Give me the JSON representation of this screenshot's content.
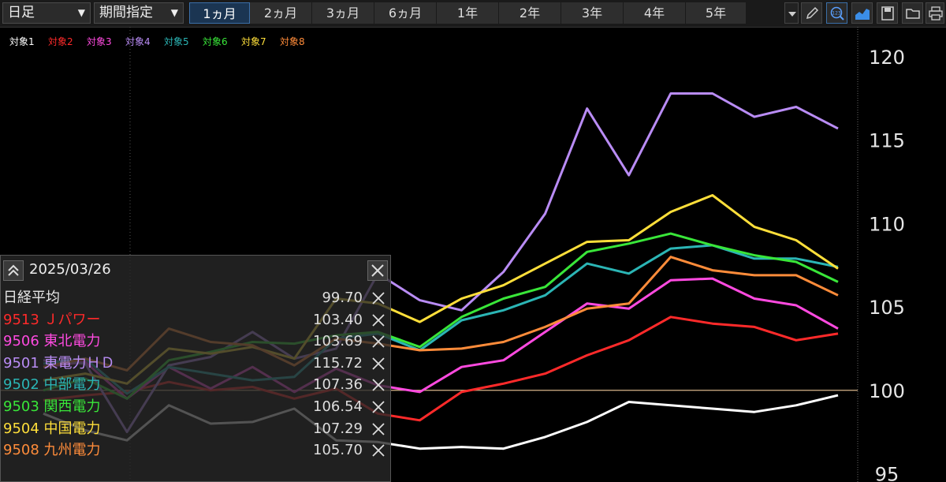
{
  "toolbar": {
    "interval_label": "日足",
    "range_mode_label": "期間指定",
    "periods": [
      "1ヵ月",
      "2ヵ月",
      "3ヵ月",
      "6ヵ月",
      "1年",
      "2年",
      "3年",
      "4年",
      "5年"
    ],
    "active_period": "1ヵ月",
    "icons": [
      "dropdown-icon",
      "pencil-icon",
      "indicator-icon",
      "area-chart-icon",
      "save-icon",
      "folder-icon",
      "print-icon"
    ]
  },
  "legend": [
    {
      "label": "対象1",
      "color": "#ffffff"
    },
    {
      "label": "対象2",
      "color": "#ff2a2a"
    },
    {
      "label": "対象3",
      "color": "#ff4ae0"
    },
    {
      "label": "対象4",
      "color": "#b98cf5"
    },
    {
      "label": "対象5",
      "color": "#2bb5b5"
    },
    {
      "label": "対象6",
      "color": "#39e639"
    },
    {
      "label": "対象7",
      "color": "#ffdf3a"
    },
    {
      "label": "対象8",
      "color": "#ff8c3a"
    }
  ],
  "panel": {
    "date": "2025/03/26",
    "rows": [
      {
        "name": "日経平均",
        "value": "99.70",
        "color": "#ffffff"
      },
      {
        "name": "9513 Ｊパワー",
        "value": "103.40",
        "color": "#ff2a2a"
      },
      {
        "name": "9506 東北電力",
        "value": "103.69",
        "color": "#ff4ae0"
      },
      {
        "name": "9501 東電力ＨＤ",
        "value": "115.72",
        "color": "#b98cf5"
      },
      {
        "name": "9502 中部電力",
        "value": "107.36",
        "color": "#2bb5b5"
      },
      {
        "name": "9503 関西電力",
        "value": "106.54",
        "color": "#39e639"
      },
      {
        "name": "9504 中国電力",
        "value": "107.29",
        "color": "#ffdf3a"
      },
      {
        "name": "9508 九州電力",
        "value": "105.70",
        "color": "#ff8c3a"
      }
    ]
  },
  "chart_data": {
    "type": "line",
    "y_ticks": [
      95,
      100,
      105,
      110,
      115,
      120
    ],
    "ylim": [
      94.5,
      121.8
    ],
    "baseline": 100,
    "baseline_color": "#d8b48a",
    "grid": "vertical dotted",
    "x_points": 22,
    "series": [
      {
        "name": "日経平均",
        "color": "#ffffff",
        "values": [
          98.6,
          97.6,
          97.0,
          99.1,
          98.0,
          98.1,
          98.9,
          97.0,
          96.9,
          96.5,
          96.6,
          96.5,
          97.2,
          98.1,
          99.3,
          99.1,
          98.9,
          98.7,
          99.1,
          99.7,
          null,
          null
        ]
      },
      {
        "name": "9513 Ｊパワー",
        "color": "#ff2a2a",
        "values": [
          99.4,
          99.7,
          99.9,
          100.5,
          100.0,
          100.2,
          99.5,
          100.1,
          98.6,
          98.2,
          99.9,
          100.4,
          101.0,
          102.1,
          103.0,
          104.4,
          104.0,
          103.8,
          103.0,
          103.4,
          null,
          null
        ]
      },
      {
        "name": "9506 東北電力",
        "color": "#ff4ae0",
        "values": [
          101.4,
          101.7,
          99.5,
          101.4,
          100.1,
          101.4,
          99.9,
          101.3,
          100.3,
          99.9,
          101.4,
          101.8,
          103.5,
          105.2,
          104.9,
          106.6,
          106.7,
          105.5,
          105.1,
          103.7,
          null,
          null
        ]
      },
      {
        "name": "9501 東電力ＨＤ",
        "color": "#b98cf5",
        "values": [
          101.8,
          101.6,
          97.5,
          101.5,
          102.0,
          103.5,
          101.9,
          102.5,
          107.0,
          105.4,
          104.8,
          107.1,
          110.6,
          116.9,
          112.9,
          117.8,
          117.8,
          116.4,
          117.0,
          115.7,
          null,
          null
        ]
      },
      {
        "name": "9502 中部電力",
        "color": "#2bb5b5",
        "values": [
          101.6,
          101.9,
          99.8,
          101.4,
          101.0,
          100.6,
          100.8,
          103.1,
          103.4,
          102.4,
          104.2,
          104.8,
          105.7,
          107.6,
          107.0,
          108.5,
          108.7,
          107.9,
          107.9,
          107.4,
          null,
          null
        ]
      },
      {
        "name": "9503 関西電力",
        "color": "#39e639",
        "values": [
          100.0,
          100.7,
          99.5,
          101.8,
          102.3,
          102.9,
          102.8,
          103.3,
          103.5,
          102.6,
          104.4,
          105.5,
          106.2,
          108.3,
          108.8,
          109.4,
          108.7,
          108.1,
          107.7,
          106.5,
          null,
          null
        ]
      },
      {
        "name": "9504 中国電力",
        "color": "#ffdf3a",
        "values": [
          100.6,
          101.0,
          100.4,
          102.5,
          102.2,
          102.6,
          101.9,
          105.5,
          105.2,
          104.1,
          105.5,
          106.3,
          107.6,
          108.9,
          109.0,
          110.7,
          111.7,
          109.8,
          109.0,
          107.3,
          null,
          null
        ]
      },
      {
        "name": "9508 九州電力",
        "color": "#ff8c3a",
        "values": [
          101.4,
          101.9,
          101.2,
          103.7,
          102.9,
          102.7,
          101.5,
          103.1,
          102.8,
          102.4,
          102.5,
          102.9,
          103.8,
          104.9,
          105.2,
          108.0,
          107.2,
          106.9,
          106.9,
          105.7,
          null,
          null
        ]
      }
    ]
  }
}
